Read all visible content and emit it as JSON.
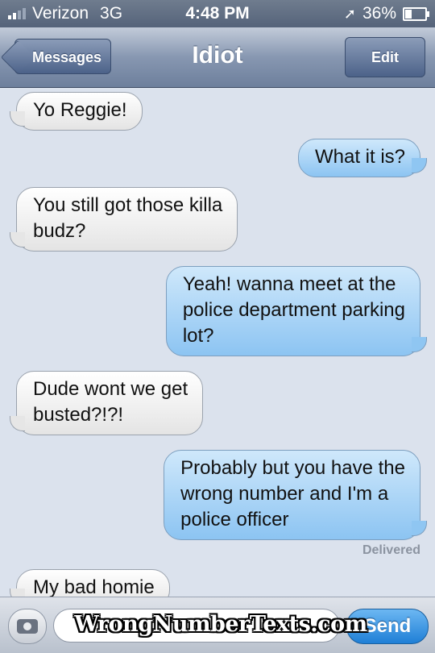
{
  "status_bar": {
    "carrier": "Verizon",
    "network": "3G",
    "time": "4:48 PM",
    "battery": "36%",
    "battery_level": 0.36,
    "signal_bars": 2
  },
  "nav": {
    "back_label": "Messages",
    "title": "Idiot",
    "edit_label": "Edit"
  },
  "messages": [
    {
      "direction": "in",
      "text": "Yo Reggie!"
    },
    {
      "direction": "out",
      "text": "What it is?"
    },
    {
      "direction": "in",
      "text": "You still got those killa\nbudz?"
    },
    {
      "direction": "out",
      "text": "Yeah! wanna meet at the\npolice department parking\nlot?"
    },
    {
      "direction": "in",
      "text": "Dude wont we get\nbusted?!?!"
    },
    {
      "direction": "out",
      "text": "Probably but you have the\nwrong number and I'm a\npolice officer"
    },
    {
      "direction": "in",
      "text": "My bad homie"
    }
  ],
  "delivered_label": "Delivered",
  "input_bar": {
    "send_label": "Send",
    "watermark": "WrongNumberTexts.com"
  },
  "colors": {
    "outgoing_bubble": "#8cc4f2",
    "incoming_bubble": "#e4e4e4",
    "thread_background": "#dbe2ed",
    "send_button": "#1f7fd6"
  }
}
